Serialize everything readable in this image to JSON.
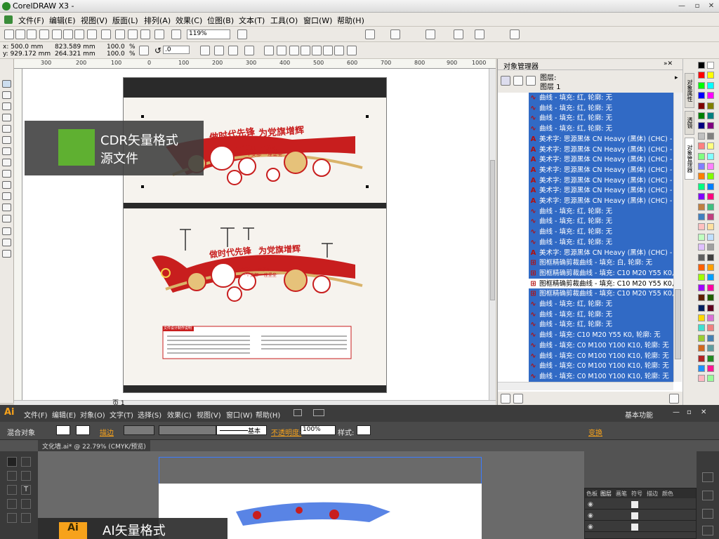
{
  "coreldraw": {
    "title": "CorelDRAW X3 -",
    "menu": [
      "文件(F)",
      "编辑(E)",
      "视图(V)",
      "版面(L)",
      "排列(A)",
      "效果(C)",
      "位图(B)",
      "文本(T)",
      "工具(O)",
      "窗口(W)",
      "帮助(H)"
    ],
    "zoom": "119%",
    "props": {
      "x": "x: 500.0 mm",
      "y": "y: 929.172 mm",
      "w": "823.589 mm",
      "h": "264.321 mm",
      "sx": "100.0",
      "sy": "100.0",
      "pct1": "%",
      "pct2": "%",
      "rot": ".0"
    },
    "ruler_labels": [
      "300",
      "200",
      "100",
      "0",
      "100",
      "200",
      "300",
      "400",
      "500",
      "600",
      "700",
      "800",
      "900",
      "1000"
    ],
    "page_nav": "页 1",
    "overlay": {
      "line1": "CDR矢量格式",
      "line2": "源文件"
    },
    "design": {
      "slogan1": "做时代先锋",
      "slogan2": "为党旗增辉",
      "sub1": "一个党员 一面旗帜",
      "sub2": "一个支部 一座堡垒",
      "info_title": "文件设计制作说明"
    }
  },
  "object_manager": {
    "title": "对象管理器",
    "layer_header": "图层:",
    "layer_name": "图层 1",
    "rows": [
      {
        "icon": "curve",
        "text": "曲线 - 填充: 红, 轮廓: 无",
        "selected": true
      },
      {
        "icon": "curve",
        "text": "曲线 - 填充: 红, 轮廓: 无",
        "selected": true
      },
      {
        "icon": "curve",
        "text": "曲线 - 填充: 红, 轮廓: 无",
        "selected": true
      },
      {
        "icon": "curve",
        "text": "曲线 - 填充: 红, 轮廓: 无",
        "selected": true
      },
      {
        "icon": "text",
        "text": "美术字: 思源黑体 CN Heavy (黑体) (CHC) - 填",
        "selected": true
      },
      {
        "icon": "text",
        "text": "美术字: 思源黑体 CN Heavy (黑体) (CHC) - 填",
        "selected": true
      },
      {
        "icon": "text",
        "text": "美术字: 思源黑体 CN Heavy (黑体) (CHC) - 填",
        "selected": true
      },
      {
        "icon": "text",
        "text": "美术字: 思源黑体 CN Heavy (黑体) (CHC) - 填",
        "selected": true
      },
      {
        "icon": "text",
        "text": "美术字: 思源黑体 CN Heavy (黑体) (CHC) - 填",
        "selected": true
      },
      {
        "icon": "text",
        "text": "美术字: 思源黑体 CN Heavy (黑体) (CHC) - 填",
        "selected": true
      },
      {
        "icon": "text",
        "text": "美术字: 思源黑体 CN Heavy (黑体) (CHC) - 填",
        "selected": true
      },
      {
        "icon": "curve",
        "text": "曲线 - 填充: 红, 轮廓: 无",
        "selected": true
      },
      {
        "icon": "curve",
        "text": "曲线 - 填充: 红, 轮廓: 无",
        "selected": true
      },
      {
        "icon": "curve",
        "text": "曲线 - 填充: 红, 轮廓: 无",
        "selected": true
      },
      {
        "icon": "curve",
        "text": "曲线 - 填充: 红, 轮廓: 无",
        "selected": true
      },
      {
        "icon": "text",
        "text": "美术字: 思源黑体 CN Heavy (黑体) (CHC) - 填",
        "selected": true
      },
      {
        "icon": "group",
        "text": "图框精确剪裁曲线 - 填充: 白, 轮廓: 无",
        "selected": true
      },
      {
        "icon": "group",
        "text": "图框精确剪裁曲线 - 填充: C10 M20 Y55 K0, 轮",
        "selected": true
      },
      {
        "icon": "group",
        "text": "图框精确剪裁曲线 - 填充: C10 M20 Y55 K0, 轮",
        "selected": false
      },
      {
        "icon": "group",
        "text": "图框精确剪裁曲线 - 填充: C10 M20 Y55 K0, 轮",
        "selected": true
      },
      {
        "icon": "curve",
        "text": "曲线 - 填充: 红, 轮廓: 无",
        "selected": true
      },
      {
        "icon": "curve",
        "text": "曲线 - 填充: 红, 轮廓: 无",
        "selected": true
      },
      {
        "icon": "curve",
        "text": "曲线 - 填充: 红, 轮廓: 无",
        "selected": true
      },
      {
        "icon": "curve",
        "text": "曲线 - 填充: C10 M20 Y55 K0, 轮廓: 无",
        "selected": true
      },
      {
        "icon": "curve",
        "text": "曲线 - 填充: C0 M100 Y100 K10, 轮廓: 无",
        "selected": true
      },
      {
        "icon": "curve",
        "text": "曲线 - 填充: C0 M100 Y100 K10, 轮廓: 无",
        "selected": true
      },
      {
        "icon": "curve",
        "text": "曲线 - 填充: C0 M100 Y100 K10, 轮廓: 无",
        "selected": true
      },
      {
        "icon": "curve",
        "text": "曲线 - 填充: C0 M100 Y100 K10, 轮廓: 无",
        "selected": true
      },
      {
        "icon": "curve",
        "text": "曲线 - 填充: C0 M100 Y100 K10, 轮廓: 无",
        "selected": true
      }
    ]
  },
  "dock_tabs": [
    "对象属性",
    "透镜",
    "对象管理器"
  ],
  "palette_colors": [
    "#000000",
    "#ffffff",
    "#ff0000",
    "#ffff00",
    "#00ff00",
    "#00ffff",
    "#0000ff",
    "#ff00ff",
    "#800000",
    "#808000",
    "#008000",
    "#008080",
    "#000080",
    "#800080",
    "#c0c0c0",
    "#808080",
    "#ff8080",
    "#ffff80",
    "#80ff80",
    "#80ffff",
    "#8080ff",
    "#ff80ff",
    "#ff8000",
    "#80ff00",
    "#00ff80",
    "#0080ff",
    "#8000ff",
    "#ff0080",
    "#c08040",
    "#40c080",
    "#4080c0",
    "#c04080",
    "#ffc0c0",
    "#ffe0a0",
    "#c0ffc0",
    "#c0e0ff",
    "#e0c0ff",
    "#a0a0a0",
    "#606060",
    "#404040",
    "#ff6000",
    "#ffa000",
    "#a0ff00",
    "#00a0ff",
    "#a000ff",
    "#ff00a0",
    "#602000",
    "#206000",
    "#002060",
    "#600020",
    "#ffd700",
    "#da70d6",
    "#40e0d0",
    "#f08080",
    "#9acd32",
    "#4682b4",
    "#d2691e",
    "#5f9ea0",
    "#b22222",
    "#228b22",
    "#1e90ff",
    "#ff1493",
    "#ffb6c1",
    "#98fb98"
  ],
  "illustrator": {
    "logo": "Ai",
    "menu": [
      "文件(F)",
      "编辑(E)",
      "对象(O)",
      "文字(T)",
      "选择(S)",
      "效果(C)",
      "视图(V)",
      "窗口(W)",
      "帮助(H)"
    ],
    "workspace": "基本功能",
    "ctrl": {
      "label": "混合对象",
      "stroke": "描边",
      "basic": "基本",
      "opacity_label": "不透明度:",
      "opacity": "100%",
      "style": "样式:",
      "transform": "变换"
    },
    "doc_tab": "文化墙.ai* @ 22.79% (CMYK/预览)",
    "panel_tabs": [
      "色板",
      "图层",
      "画笔",
      "符号",
      "描边",
      "颜色"
    ],
    "overlay_title": "AI矢量格式",
    "overlay_logo": "Ai"
  }
}
